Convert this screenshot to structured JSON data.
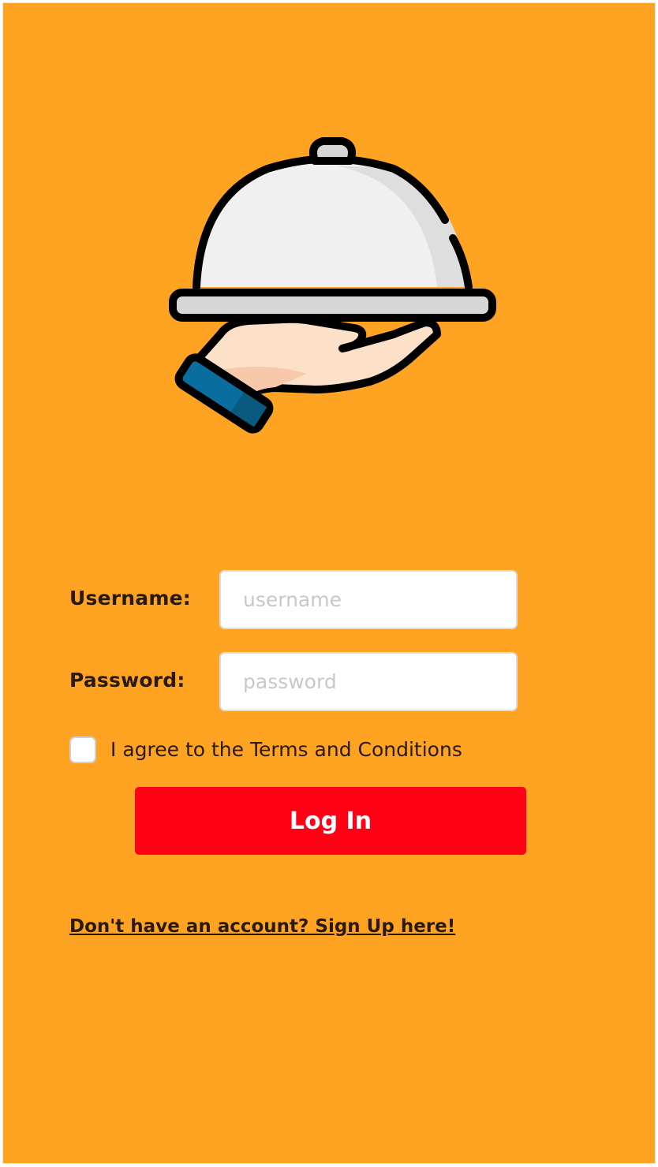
{
  "colors": {
    "background": "#ffa322",
    "button": "#ff0015",
    "text": "#2a1a0c"
  },
  "logo": {
    "icon": "serving-cloche-hand-icon"
  },
  "form": {
    "username_label": "Username:",
    "username_placeholder": "username",
    "username_value": "",
    "password_label": "Password:",
    "password_placeholder": "password",
    "password_value": "",
    "terms_checked": false,
    "terms_label": "I agree to the Terms and Conditions",
    "login_label": "Log In"
  },
  "footer": {
    "signup_link": "Don't have an account? Sign Up here!"
  }
}
